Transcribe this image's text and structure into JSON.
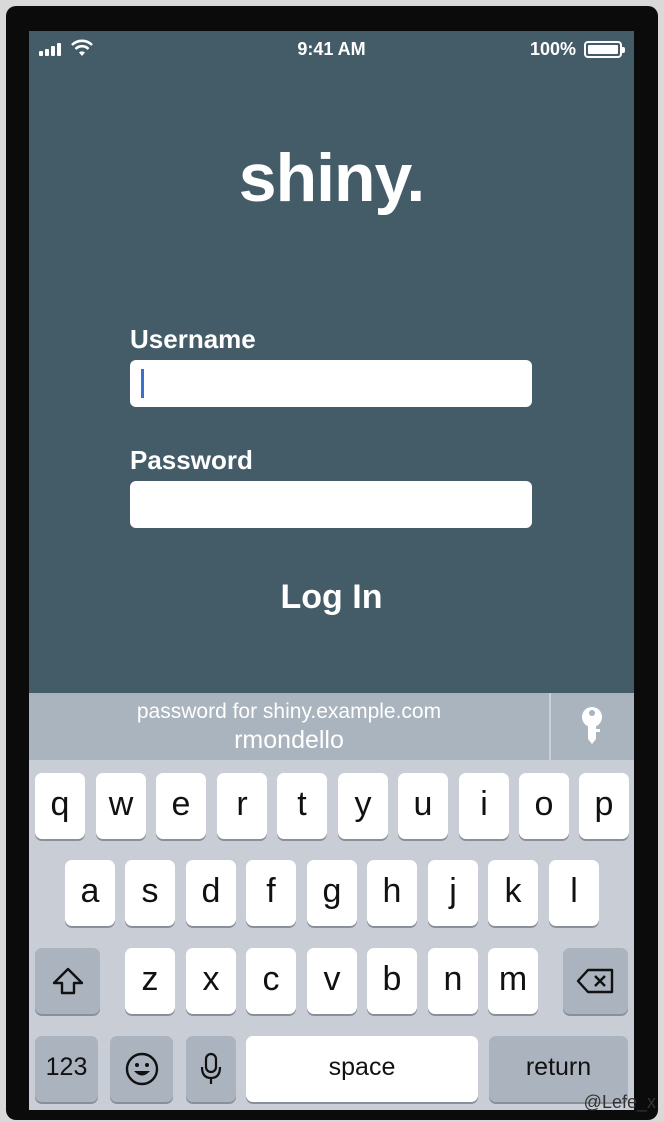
{
  "status": {
    "time": "9:41 AM",
    "battery": "100%"
  },
  "app": {
    "logo": "shiny.",
    "username_label": "Username",
    "username_value": "",
    "password_label": "Password",
    "password_value": "",
    "login_label": "Log In"
  },
  "autofill": {
    "caption": "password for shiny.example.com",
    "account": "rmondello"
  },
  "keyboard": {
    "row1": [
      "q",
      "w",
      "e",
      "r",
      "t",
      "y",
      "u",
      "i",
      "o",
      "p"
    ],
    "row2": [
      "a",
      "s",
      "d",
      "f",
      "g",
      "h",
      "j",
      "k",
      "l"
    ],
    "row3": [
      "z",
      "x",
      "c",
      "v",
      "b",
      "n",
      "m"
    ],
    "numbers": "123",
    "space": "space",
    "return": "return"
  },
  "watermark": "@Lefe_x"
}
